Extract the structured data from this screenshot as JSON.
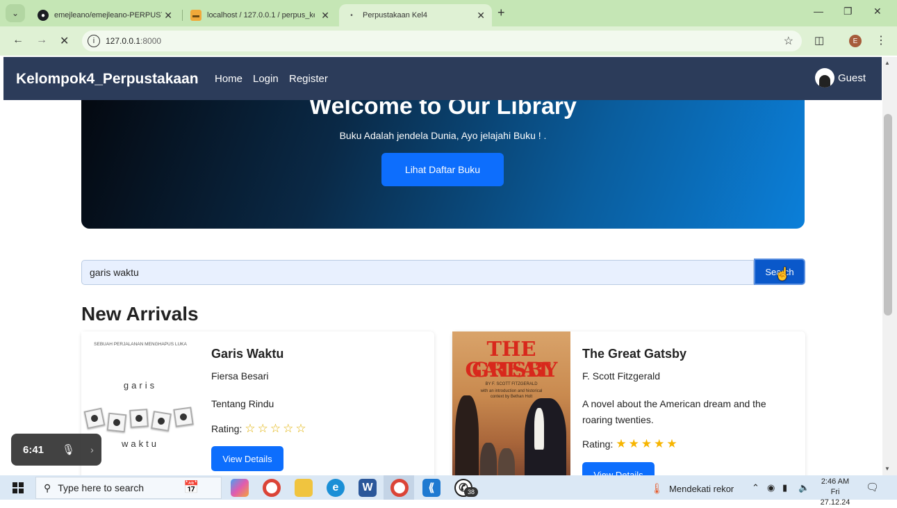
{
  "browser": {
    "tabs": [
      {
        "title": "emejleano/emejleano-PERPUSTAKAAN",
        "icon": "github-icon"
      },
      {
        "title": "localhost / 127.0.0.1 / perpus_kel4",
        "icon": "phpmyadmin-icon"
      },
      {
        "title": "Perpustakaan Kel4",
        "icon": "loading-icon",
        "active": true
      }
    ],
    "new_tab": "+",
    "address": {
      "host": "127.0.0.1",
      "port": ":8000"
    }
  },
  "navbar": {
    "brand": "Kelompok4_Perpustakaan",
    "links": [
      "Home",
      "Login",
      "Register"
    ],
    "user": "Guest"
  },
  "hero": {
    "title": "Welcome to Our Library",
    "subtitle": "Buku Adalah jendela Dunia, Ayo jelajahi Buku ! .",
    "button": "Lihat Daftar Buku"
  },
  "search": {
    "value": "garis waktu",
    "button": "Search"
  },
  "section_title": "New Arrivals",
  "books": [
    {
      "title": "Garis Waktu",
      "author": "Fiersa Besari",
      "description": "Tentang Rindu",
      "rating_label": "Rating:",
      "rating": 0,
      "max_rating": 5,
      "button": "View Details",
      "cover": {
        "top_text": "SEBUAH PERJALANAN MENGHAPUS LUKA",
        "word1": "garis",
        "word2": "waktu"
      }
    },
    {
      "title": "The Great Gatsby",
      "author": "F. Scott Fitzgerald",
      "description": "A novel about the American dream and the roaring twenties.",
      "rating_label": "Rating:",
      "rating": 5,
      "max_rating": 5,
      "button": "View Details",
      "cover": {
        "title_line1": "THE GREAT",
        "title_line2": "GATSBY",
        "byline": "BY F. SCOTT FITZGERALD",
        "note": "with an introduction and historical context by Bethan Holt"
      }
    }
  ],
  "recorder": {
    "time": "6:41"
  },
  "taskbar": {
    "search_placeholder": "Type here to search",
    "whatsapp_badge": "38",
    "weather_text": "Mendekati rekor",
    "time": "2:46 AM",
    "date": "Fri 27.12.24"
  },
  "colors": {
    "navbar": "#2c3c5a",
    "primary": "#0d6efd",
    "tabstrip": "#c5e6b5",
    "star": "#f7b500"
  }
}
